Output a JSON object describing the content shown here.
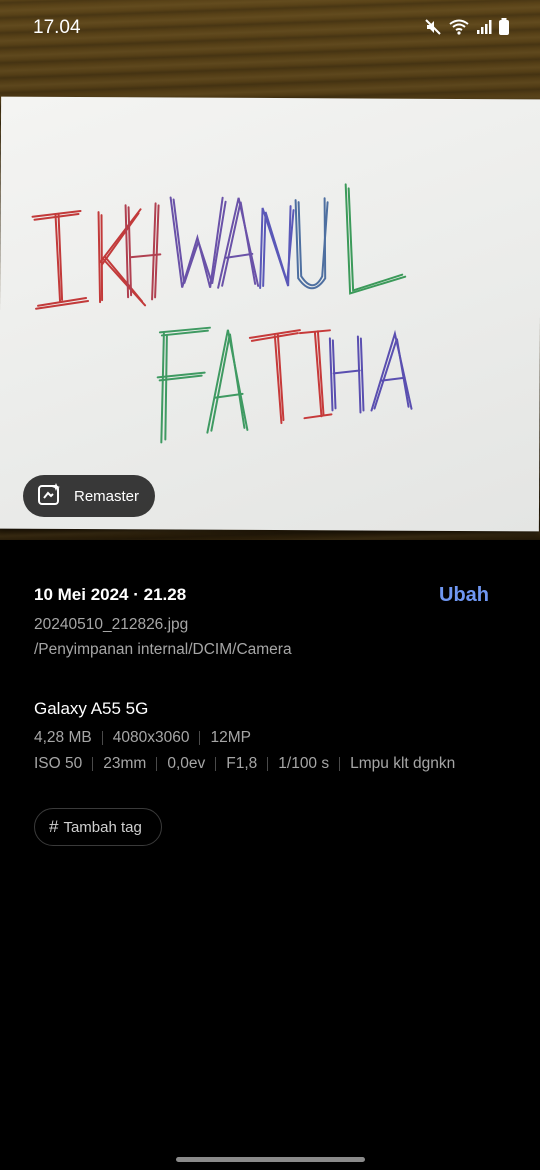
{
  "status_bar": {
    "time": "17.04",
    "icons": [
      "mute-icon",
      "wifi-icon",
      "signal-icon",
      "battery-icon"
    ]
  },
  "photo": {
    "handwriting_line1": "IKHWANUL",
    "handwriting_line2": "FATIHA",
    "remaster_label": "Remaster"
  },
  "details": {
    "datetime": "10 Mei 2024 · 21.28",
    "edit_label": "Ubah",
    "filename": "20240510_212826.jpg",
    "path": "/Penyimpanan internal/DCIM/Camera",
    "device": "Galaxy A55 5G",
    "file_specs": [
      "4,28 MB",
      "4080x3060",
      "12MP"
    ],
    "camera_specs": [
      "ISO 50",
      "23mm",
      "0,0ev",
      "F1,8",
      "1/100 s",
      "Lmpu klt dgnkn"
    ],
    "tag_label": "Tambah tag"
  },
  "colors": {
    "accent": "#6f97f2",
    "secondary_text": "#a6a6a6",
    "background": "#000000"
  }
}
